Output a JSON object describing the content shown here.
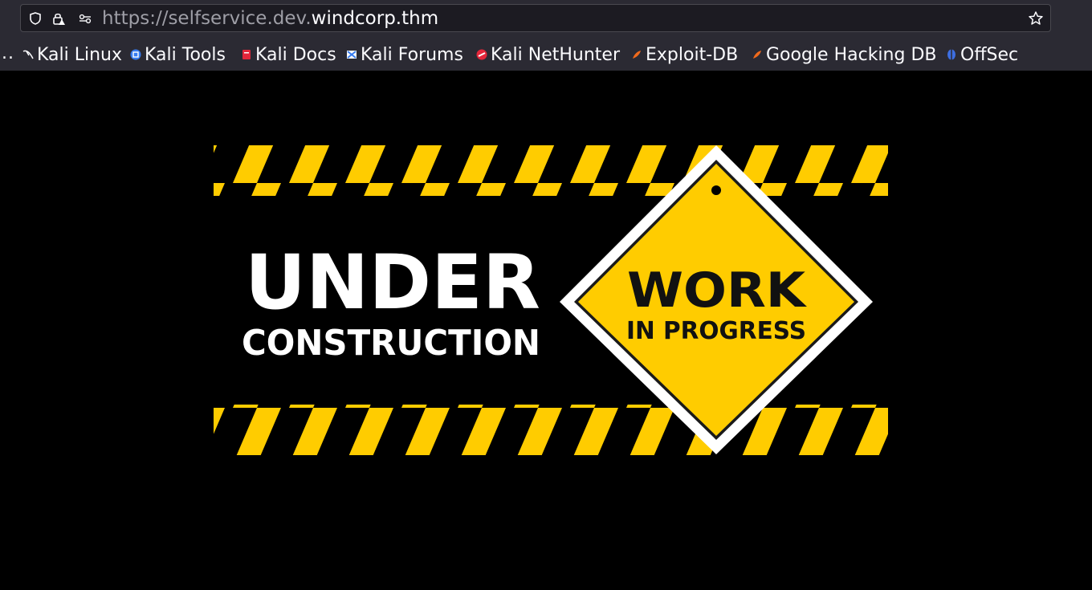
{
  "browser": {
    "url_prefix": "https://selfservice.dev.",
    "url_host": "windcorp.thm"
  },
  "bookmarks": {
    "overflow_label": "..",
    "items": [
      {
        "label": "Kali Linux"
      },
      {
        "label": "Kali Tools"
      },
      {
        "label": "Kali Docs"
      },
      {
        "label": "Kali Forums"
      },
      {
        "label": "Kali NetHunter"
      },
      {
        "label": "Exploit-DB"
      },
      {
        "label": "Google Hacking DB"
      },
      {
        "label": "OffSec"
      }
    ]
  },
  "banner": {
    "line1": "UNDER",
    "line2": "CONSTRUCTION",
    "sign_line1": "WORK",
    "sign_line2": "IN PROGRESS"
  },
  "colors": {
    "hazard_yellow": "#ffcc00",
    "background": "#000000",
    "toolbar": "#2b2a33"
  }
}
